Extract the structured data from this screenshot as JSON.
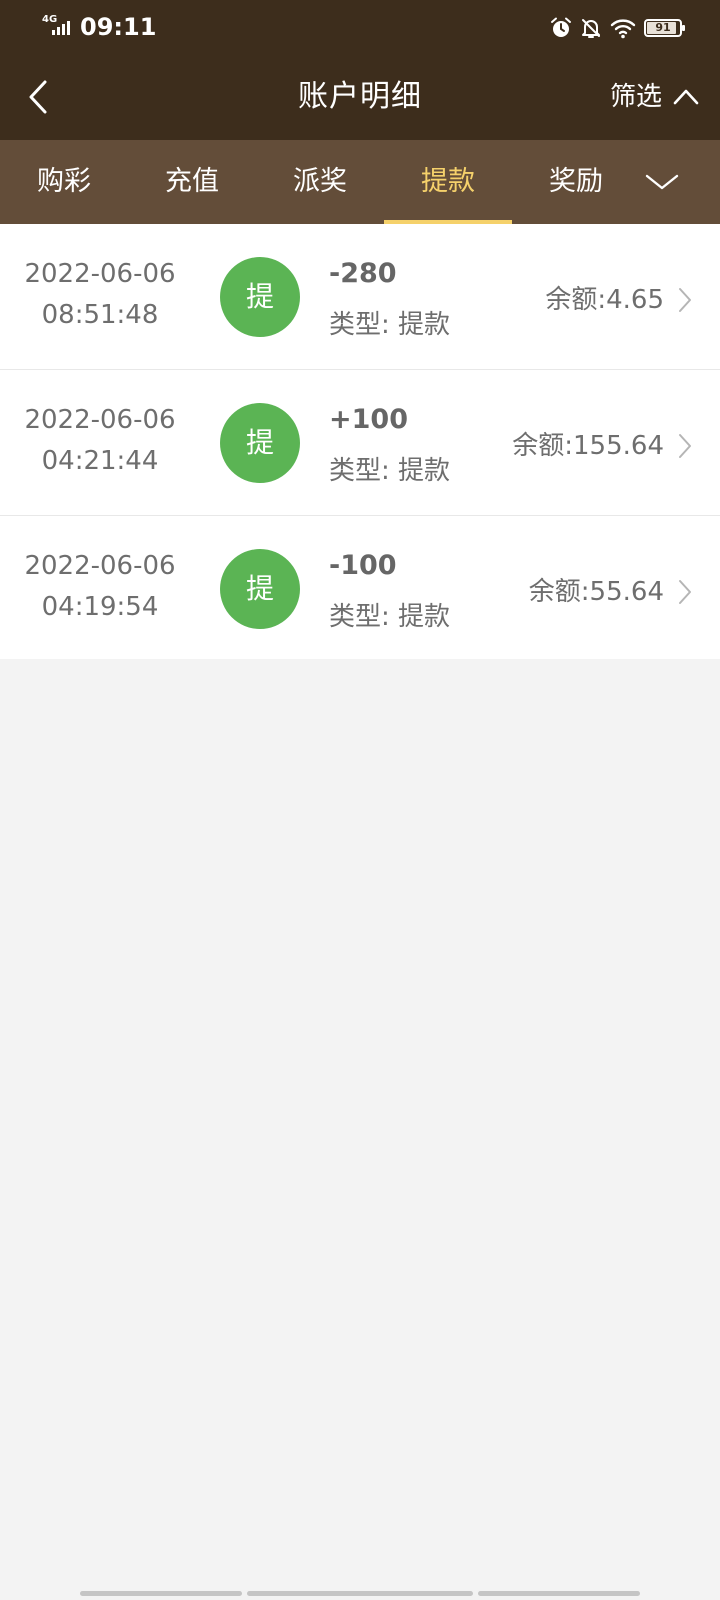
{
  "status_bar": {
    "network": "4G",
    "time": "09:11",
    "battery": "91"
  },
  "header": {
    "title": "账户明细",
    "filter_label": "筛选"
  },
  "tabs": [
    {
      "label": "购彩",
      "active": false
    },
    {
      "label": "充值",
      "active": false
    },
    {
      "label": "派奖",
      "active": false
    },
    {
      "label": "提款",
      "active": true
    },
    {
      "label": "奖励",
      "active": false
    }
  ],
  "records": [
    {
      "date": "2022-06-06",
      "time": "08:51:48",
      "badge": "提",
      "amount": "-280",
      "type": "类型: 提款",
      "balance": "余额:4.65"
    },
    {
      "date": "2022-06-06",
      "time": "04:21:44",
      "badge": "提",
      "amount": "+100",
      "type": "类型: 提款",
      "balance": "余额:155.64"
    },
    {
      "date": "2022-06-06",
      "time": "04:19:54",
      "badge": "提",
      "amount": "-100",
      "type": "类型: 提款",
      "balance": "余额:55.64"
    }
  ],
  "colors": {
    "header_bg": "#3d2d1c",
    "tabbar_bg": "#634d39",
    "active_tab": "#f5d16b",
    "badge": "#5bb454",
    "page_bg": "#f3f3f3"
  },
  "icons": {
    "back": "chevron-left-icon",
    "filter_toggle": "chevron-up-icon",
    "tabs_more": "chevron-down-icon",
    "row_detail": "chevron-right-icon",
    "alarm": "alarm-icon",
    "mute": "bell-off-icon",
    "wifi": "wifi-icon"
  }
}
